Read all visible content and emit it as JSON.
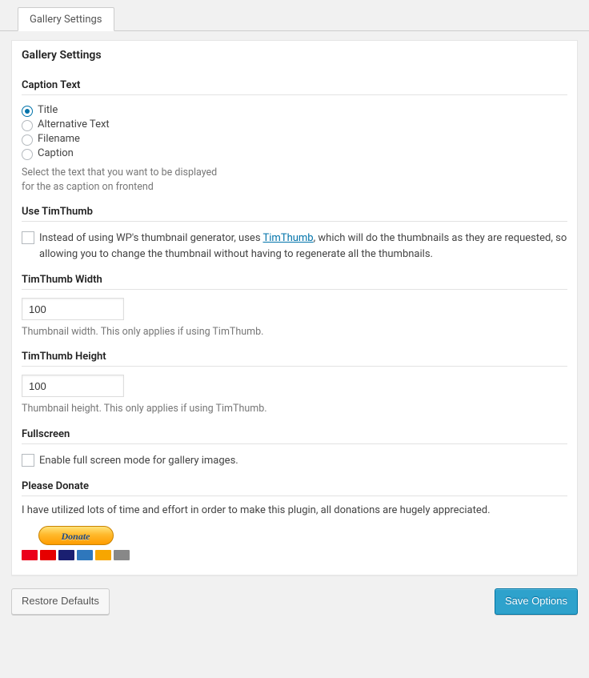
{
  "tab": {
    "label": "Gallery Settings"
  },
  "panel": {
    "title": "Gallery Settings"
  },
  "caption": {
    "heading": "Caption Text",
    "options": [
      "Title",
      "Alternative Text",
      "Filename",
      "Caption"
    ],
    "selected": 0,
    "desc": "Select the text that you want to be displayed for the as caption on frontend"
  },
  "timthumb": {
    "heading": "Use TimThumb",
    "desc_before": "Instead of using WP's thumbnail generator, uses ",
    "link_text": "TimThumb",
    "desc_after": ", which will do the thumbnails as they are requested, so allowing you to change the thumbnail without having to regenerate all the thumbnails."
  },
  "tt_width": {
    "heading": "TimThumb Width",
    "value": "100",
    "desc": "Thumbnail width. This only applies if using TimThumb."
  },
  "tt_height": {
    "heading": "TimThumb Height",
    "value": "100",
    "desc": "Thumbnail height. This only applies if using TimThumb."
  },
  "fullscreen": {
    "heading": "Fullscreen",
    "label": "Enable full screen mode for gallery images."
  },
  "donate": {
    "heading": "Please Donate",
    "text": "I have utilized lots of time and effort in order to make this plugin, all donations are hugely appreciated.",
    "button": "Donate"
  },
  "footer": {
    "restore": "Restore Defaults",
    "save": "Save Options"
  }
}
